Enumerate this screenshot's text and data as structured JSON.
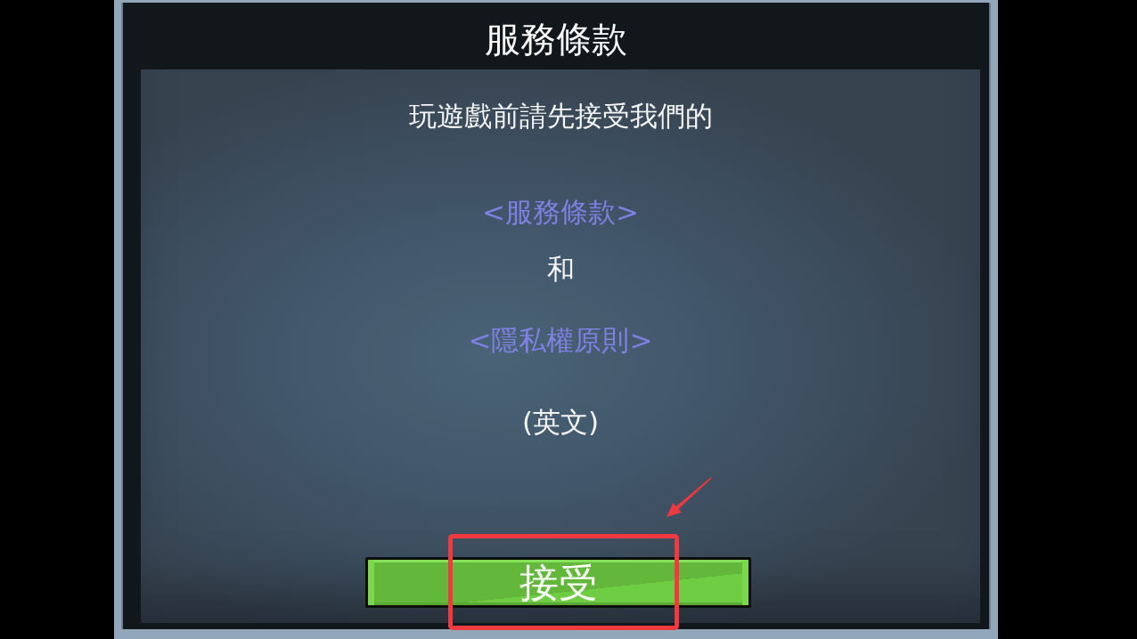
{
  "dialog": {
    "title": "服務條款",
    "lines": [
      {
        "kind": "text",
        "text": "玩遊戲前請先接受我們的"
      },
      {
        "kind": "link",
        "text": "<服務條款>"
      },
      {
        "kind": "text",
        "text": "和"
      },
      {
        "kind": "link",
        "text": "<隱私權原則>"
      },
      {
        "kind": "text",
        "text": "(英文)"
      }
    ],
    "button": {
      "label": "接受"
    }
  }
}
